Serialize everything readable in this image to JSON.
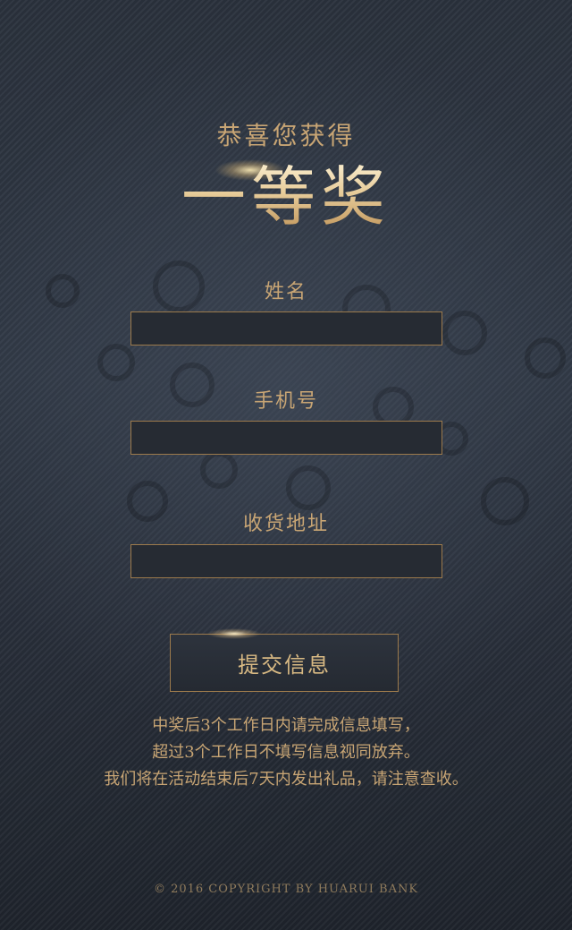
{
  "header": {
    "headline": "恭喜您获得",
    "prize": "一等奖"
  },
  "form": {
    "name_label": "姓名",
    "name_value": "",
    "phone_label": "手机号",
    "phone_value": "",
    "address_label": "收货地址",
    "address_value": ""
  },
  "submit": {
    "label": "提交信息"
  },
  "notice": {
    "lines": [
      "中奖后3个工作日内请完成信息填写，",
      "超过3个工作日不填写信息视同放弃。",
      "我们将在活动结束后7天内发出礼品，请注意查收。"
    ]
  },
  "footer": {
    "copyright": "© 2016 COPYRIGHT BY HUARUI BANK"
  },
  "colors": {
    "gold": "#c8a574",
    "background": "#2a303b",
    "border": "#9c7a4c"
  }
}
